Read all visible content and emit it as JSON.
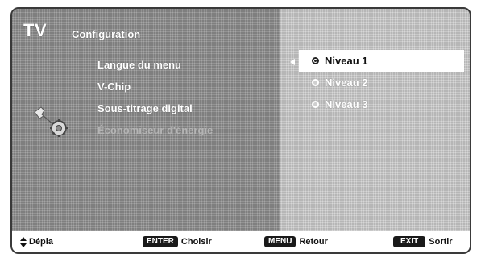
{
  "header": {
    "tv_label": "TV",
    "section_title": "Configuration"
  },
  "menu": {
    "items": [
      {
        "label": "Langue du menu",
        "enabled": true
      },
      {
        "label": "V-Chip",
        "enabled": true
      },
      {
        "label": "Sous-titrage digital",
        "enabled": true
      },
      {
        "label": "Économiseur d'énergie",
        "enabled": false
      }
    ],
    "icon": "settings-gear-icon"
  },
  "submenu": {
    "options": [
      {
        "label": "Niveau 1",
        "selected": true
      },
      {
        "label": "Niveau 2",
        "selected": false
      },
      {
        "label": "Niveau 3",
        "selected": false
      }
    ]
  },
  "footer": {
    "move_label": "Dépla",
    "enter_key": "ENTER",
    "enter_label": "Choisir",
    "menu_key": "MENU",
    "menu_label": "Retour",
    "exit_key": "EXIT",
    "exit_label": "Sortir"
  },
  "colors": {
    "left_panel": "#8c8c8c",
    "right_panel": "#c2c2c2",
    "highlight": "#ffffff",
    "key_bg": "#1a1a1a"
  }
}
